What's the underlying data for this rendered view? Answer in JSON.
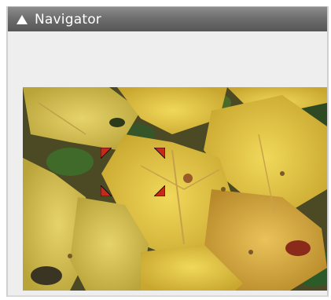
{
  "panel": {
    "title": "Navigator",
    "collapse_icon": "triangle-up-icon"
  },
  "preview": {
    "subject": "yellow-maple-leaves-photo",
    "viewport_frame_color": "#c62a1a"
  },
  "colors": {
    "titlebar_top": "#8c8c8c",
    "titlebar_bottom": "#565656",
    "panel_bg": "#eeeeee"
  }
}
